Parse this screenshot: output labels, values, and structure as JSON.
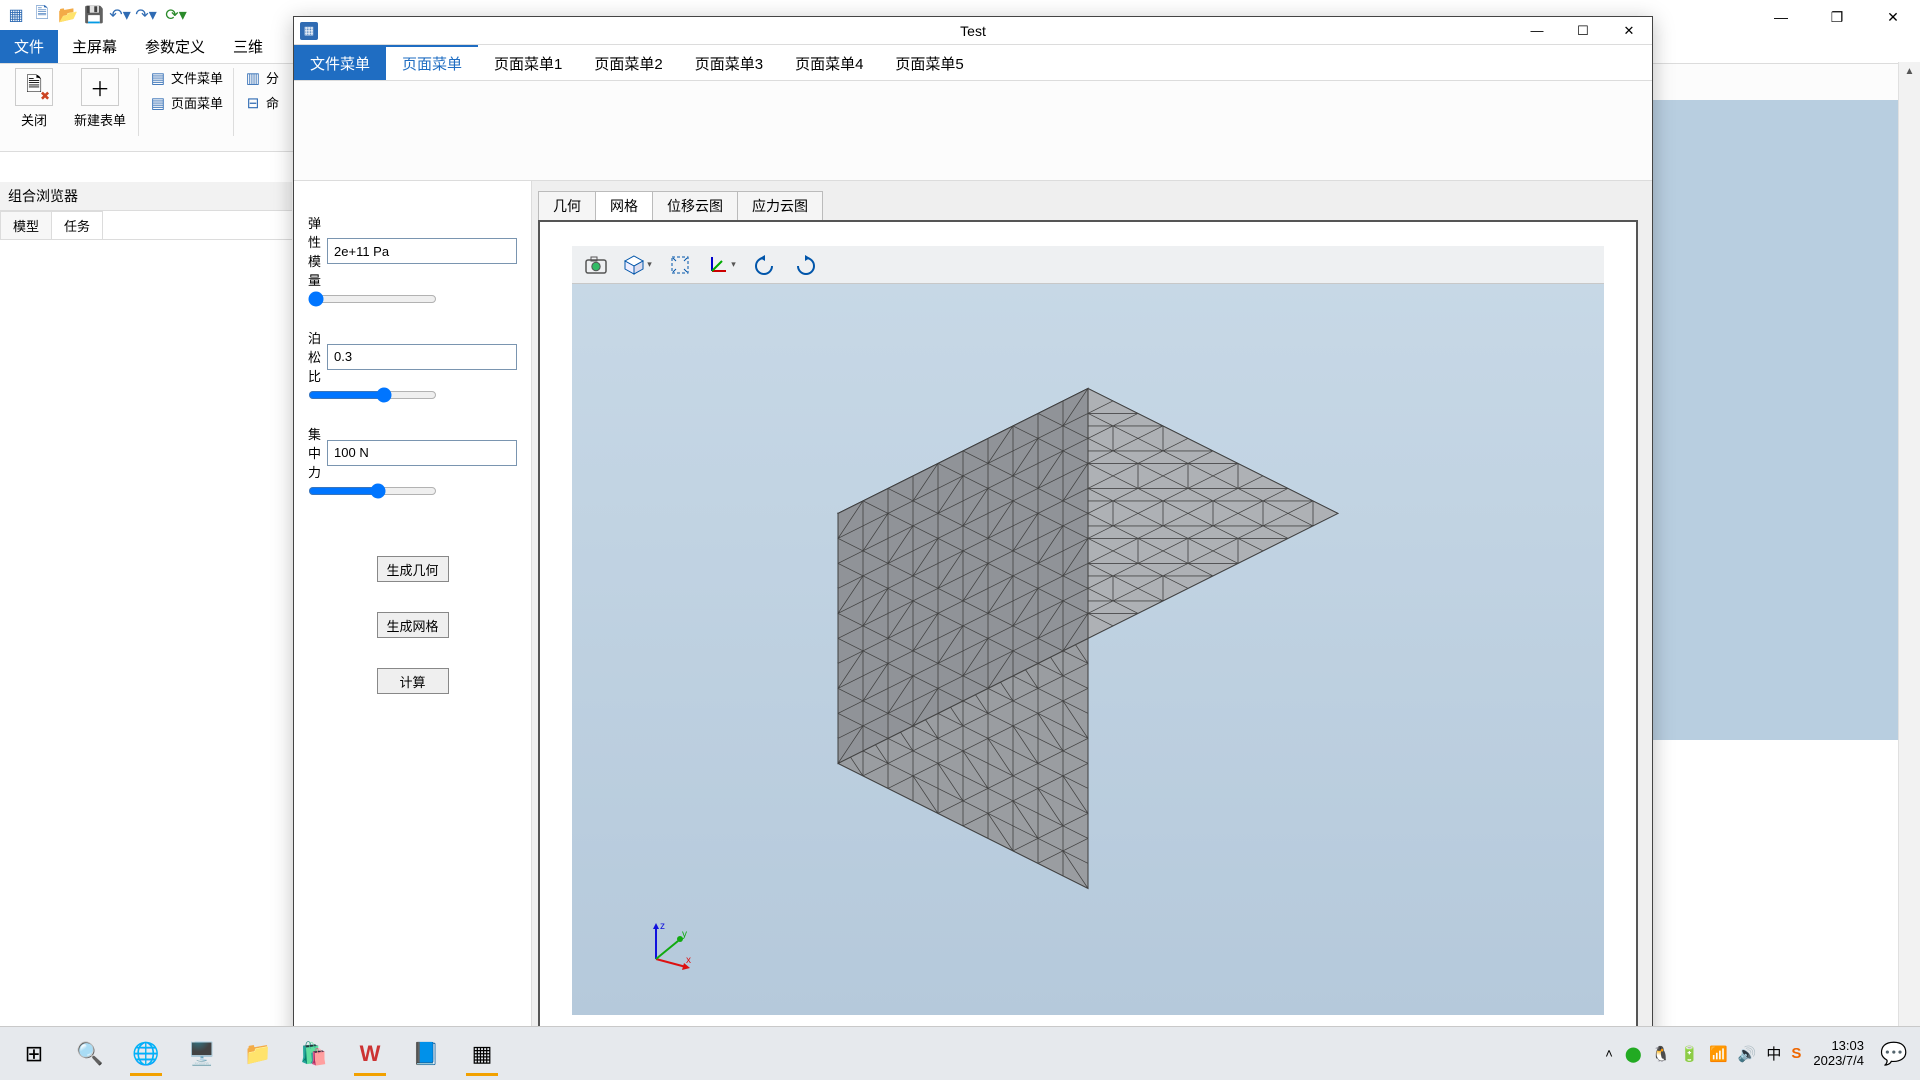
{
  "host": {
    "menus": {
      "file": "文件",
      "home": "主屏幕",
      "params": "参数定义",
      "threeD": "三维"
    },
    "ribbon": {
      "close": "关闭",
      "newForm": "新建表单",
      "fileMenu": "文件菜单",
      "pageMenu": "页面菜单",
      "split": "分",
      "cmd": "命"
    },
    "panelTitle": "组合浏览器",
    "tabs": {
      "model": "模型",
      "tasks": "任务"
    }
  },
  "child": {
    "title": "Test",
    "menus": [
      "文件菜单",
      "页面菜单",
      "页面菜单1",
      "页面菜单2",
      "页面菜单3",
      "页面菜单4",
      "页面菜单5"
    ],
    "params": {
      "elasticLabel": "弹性模量",
      "elasticValue": "2e+11 Pa",
      "poissonLabel": "泊松比",
      "poissonValue": "0.3",
      "forceLabel": "集中力",
      "forceValue": "100 N",
      "btnGeom": "生成几何",
      "btnMesh": "生成网格",
      "btnCalc": "计算"
    },
    "viewTabs": [
      "几何",
      "网格",
      "位移云图",
      "应力云图"
    ],
    "axes": {
      "x": "x",
      "y": "y",
      "z": "z"
    }
  },
  "taskbar": {
    "time": "13:03",
    "date": "2023/7/4"
  }
}
